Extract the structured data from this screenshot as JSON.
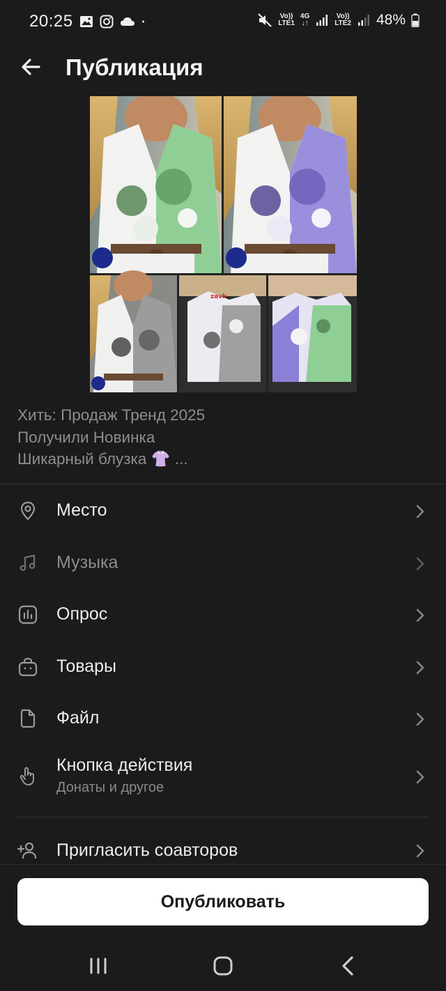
{
  "status_bar": {
    "time": "20:25",
    "net1_top": "Vo))",
    "net1_bottom": "LTE1",
    "net_4g": "4G",
    "net2_top": "Vo))",
    "net2_bottom": "LTE2",
    "battery": "48%"
  },
  "header": {
    "title": "Публикация"
  },
  "photo": {
    "badge_text": "zavk"
  },
  "caption": {
    "line1": "Хить: Продаж Тренд 2025",
    "line2": "Получили Новинка",
    "line3": "Шикарный блузка 👚 ..."
  },
  "menu": {
    "place": "Место",
    "music": "Музыка",
    "poll": "Опрос",
    "goods": "Товары",
    "file": "Файл",
    "action_button": "Кнопка действия",
    "action_button_sub": "Донаты и другое",
    "invite_coauthors": "Пригласить соавторов"
  },
  "publish_button": "Опубликовать",
  "colors": {
    "background": "#1b1b1b",
    "text_primary": "#ececec",
    "text_secondary": "#8c8c8c",
    "button_bg": "#ffffff"
  }
}
